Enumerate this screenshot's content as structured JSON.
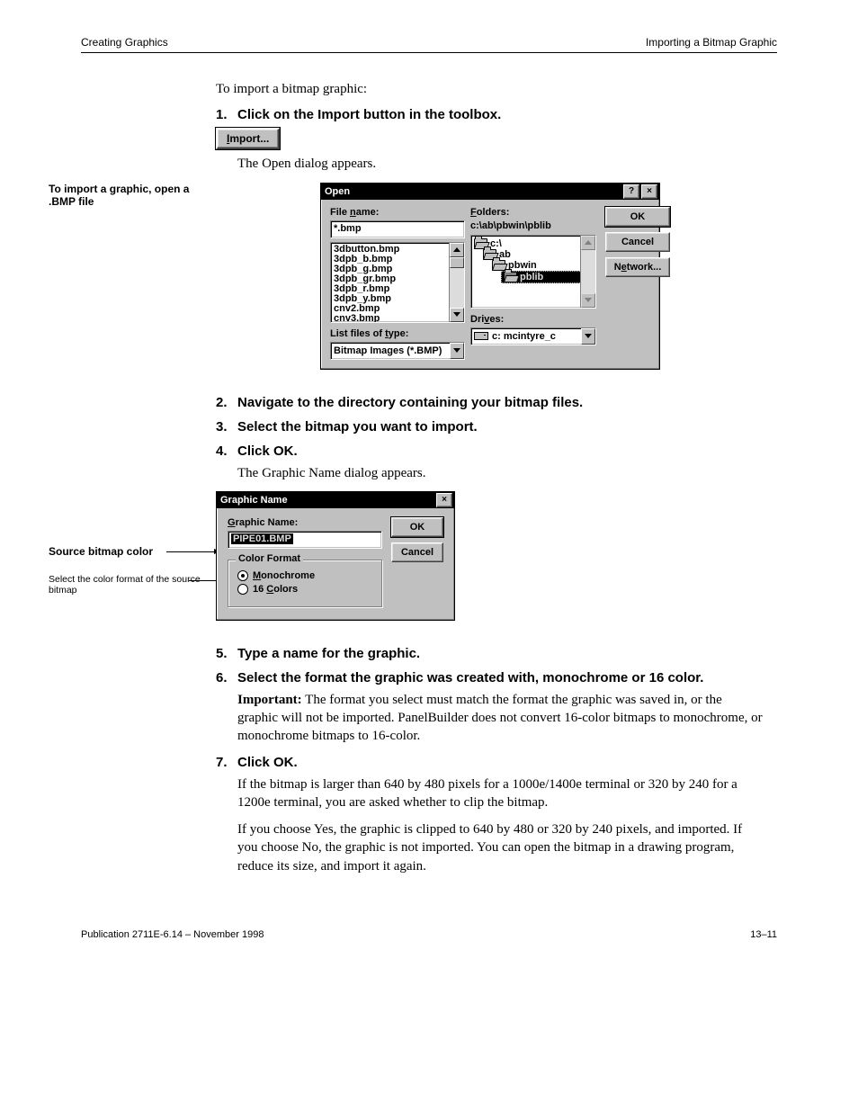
{
  "header": {
    "left": "Creating Graphics",
    "right": "Importing a Bitmap Graphic"
  },
  "section1": {
    "intro": "To import a bitmap graphic:",
    "step1_num": "1.",
    "step1_text": "Click on the Import button in the toolbox.",
    "import_button_label": "Import...",
    "after_step1": "The Open dialog appears.",
    "fig_left_label": "To import a graphic, open a .BMP file"
  },
  "open_dialog": {
    "title": "Open",
    "file_name_label": "File name:",
    "file_name_value": "*.bmp",
    "file_list": [
      "3dbutton.bmp",
      "3dpb_b.bmp",
      "3dpb_g.bmp",
      "3dpb_gr.bmp",
      "3dpb_r.bmp",
      "3dpb_y.bmp",
      "cnv2.bmp",
      "cnv3.bmp"
    ],
    "folders_label": "Folders:",
    "folders_path": "c:\\ab\\pbwin\\pblib",
    "folder_tree": [
      {
        "indent": 0,
        "label": "c:\\",
        "selected": false
      },
      {
        "indent": 1,
        "label": "ab",
        "selected": false
      },
      {
        "indent": 2,
        "label": "pbwin",
        "selected": false
      },
      {
        "indent": 3,
        "label": "pblib",
        "selected": true
      }
    ],
    "list_type_label": "List files of type:",
    "list_type_value": "Bitmap Images (*.BMP)",
    "drives_label": "Drives:",
    "drives_value": "c: mcintyre_c",
    "ok": "OK",
    "cancel": "Cancel",
    "network": "Network..."
  },
  "section2": {
    "step2_num": "2.",
    "step2_text": "Navigate to the directory containing your bitmap files.",
    "step3_num": "3.",
    "step3_text": "Select the bitmap you want to import.",
    "step4_num": "4.",
    "step4_text": "Click OK.",
    "after_step4": "The Graphic Name dialog appears.",
    "fig_left_line1": "Source bitmap color",
    "fig_left_line2": "Select the color format of the source bitmap"
  },
  "gname_dialog": {
    "title": "Graphic Name",
    "name_label": "Graphic Name:",
    "name_value": "PIPE01.BMP",
    "group_legend": "Color Format",
    "radio_mono": "Monochrome",
    "radio_16": "16 Colors",
    "ok": "OK",
    "cancel": "Cancel"
  },
  "section3": {
    "step5_num": "5.",
    "step5_text": "Type a name for the graphic.",
    "step6_num": "6.",
    "step6_text": "Select the format the graphic was created with, monochrome or 16 color.",
    "note_lead": "Important:",
    "note_body": " The format you select must match the format the graphic was saved in, or the graphic will not be imported. PanelBuilder does not convert 16-color bitmaps to monochrome, or monochrome bitmaps to 16-color.",
    "step7_num": "7.",
    "step7_text": "Click OK.",
    "after7_a": "If the bitmap is larger than 640 by 480 pixels for a 1000e/1400e terminal or 320 by 240 for a 1200e terminal, you are asked whether to clip the bitmap.",
    "after7_b": "If you choose Yes, the graphic is clipped to 640 by 480 or 320 by 240 pixels, and imported. If you choose No, the graphic is not imported. You can open the bitmap in a drawing program, reduce its size, and import it again."
  },
  "footer": {
    "left": "Publication 2711E-6.14 – November 1998",
    "right": "13–11"
  }
}
